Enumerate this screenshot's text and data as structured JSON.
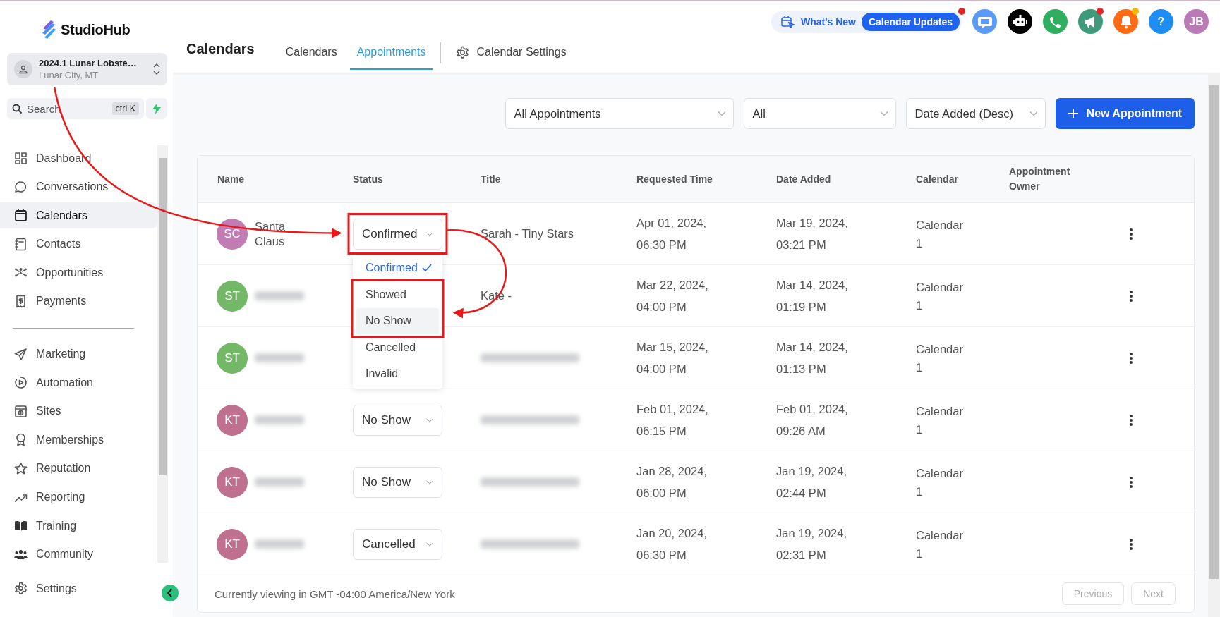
{
  "logo": {
    "text": "StudioHub"
  },
  "location": {
    "name": "2024.1 Lunar Lobste…",
    "place": "Lunar City, MT"
  },
  "search": {
    "placeholder": "Search",
    "shortcut": "ctrl K"
  },
  "sidebar": {
    "items": [
      {
        "label": "Dashboard",
        "selected": false
      },
      {
        "label": "Conversations",
        "selected": false
      },
      {
        "label": "Calendars",
        "selected": true
      },
      {
        "label": "Contacts",
        "selected": false
      },
      {
        "label": "Opportunities",
        "selected": false
      },
      {
        "label": "Payments",
        "selected": false
      }
    ],
    "more_items": [
      {
        "label": "Marketing",
        "selected": false
      },
      {
        "label": "Automation",
        "selected": false
      },
      {
        "label": "Sites",
        "selected": false
      },
      {
        "label": "Memberships",
        "selected": false
      },
      {
        "label": "Reputation",
        "selected": false
      },
      {
        "label": "Reporting",
        "selected": false
      },
      {
        "label": "Training",
        "selected": false
      },
      {
        "label": "Community",
        "selected": false
      }
    ],
    "settings": {
      "label": "Settings",
      "selected": false
    }
  },
  "header": {
    "title": "Calendars",
    "tabs": [
      {
        "label": "Calendars",
        "selected": false
      },
      {
        "label": "Appointments",
        "selected": true
      },
      {
        "label": "Calendar Settings",
        "selected": false,
        "kind": "settings"
      }
    ],
    "whats_new": {
      "label": "What's New",
      "badge": "Calendar Updates",
      "dot": true
    },
    "icons": [
      {
        "kind": "chat",
        "color": "#5b9bf8"
      },
      {
        "kind": "bot",
        "color": "#000000"
      },
      {
        "kind": "phone",
        "color": "#2fae60"
      },
      {
        "kind": "megaphone",
        "color": "#3f9a7c",
        "dot": {
          "color": "#e8262b"
        }
      },
      {
        "kind": "bell",
        "color": "#ff6a13",
        "dot": {
          "color": "#f5b800"
        }
      },
      {
        "kind": "help",
        "color": "#1e8ef5",
        "label": "?"
      },
      {
        "kind": "avatar",
        "color": "#b97ab5",
        "label": "JB"
      }
    ]
  },
  "filters": [
    {
      "value": "All Appointments"
    },
    {
      "value": "All"
    },
    {
      "value": "Date Added (Desc)"
    }
  ],
  "new_button": {
    "label": "New Appointment"
  },
  "table": {
    "columns": [
      "Name",
      "Status",
      "Title",
      "Requested Time",
      "Date Added",
      "Calendar",
      "Appointment Owner"
    ],
    "rows": [
      {
        "initials": "SC",
        "color": "#c17cb4",
        "name": "Santa Claus",
        "status": "Confirmed",
        "title": "Sarah - Tiny Stars",
        "requested": "Apr 01, 2024, 06:30 PM",
        "date_added": "Mar 19, 2024, 03:21 PM",
        "calendar": "Calendar 1",
        "status_menu": {
          "options": [
            {
              "label": "Confirmed",
              "selected": true,
              "highlighted": false
            },
            {
              "label": "Showed",
              "selected": false,
              "highlighted": false
            },
            {
              "label": "No Show",
              "selected": false,
              "highlighted": true
            },
            {
              "label": "Cancelled",
              "selected": false,
              "highlighted": false
            },
            {
              "label": "Invalid",
              "selected": false,
              "highlighted": false
            }
          ]
        }
      },
      {
        "initials": "ST",
        "color": "#72b866",
        "name_blurred": true,
        "title": "Kate -",
        "requested": "Mar 22, 2024, 04:00 PM",
        "date_added": "Mar 14, 2024, 01:19 PM",
        "calendar": "Calendar 1"
      },
      {
        "initials": "ST",
        "color": "#72b866",
        "name_blurred": true,
        "title_blurred": true,
        "requested": "Mar 15, 2024, 04:00 PM",
        "date_added": "Mar 14, 2024, 01:13 PM",
        "calendar": "Calendar 1"
      },
      {
        "initials": "KT",
        "color": "#c0708f",
        "name_blurred": true,
        "status": "No Show",
        "title_blurred": true,
        "requested": "Feb 01, 2024, 06:15 PM",
        "date_added": "Feb 01, 2024, 09:26 AM",
        "calendar": "Calendar 1"
      },
      {
        "initials": "KT",
        "color": "#c0708f",
        "name_blurred": true,
        "status": "No Show",
        "title_blurred": true,
        "requested": "Jan 28, 2024, 06:00 PM",
        "date_added": "Jan 19, 2024, 02:44 PM",
        "calendar": "Calendar 1"
      },
      {
        "initials": "KT",
        "color": "#c0708f",
        "name_blurred": true,
        "status": "Cancelled",
        "title_blurred": true,
        "requested": "Jan 20, 2024, 06:30 PM",
        "date_added": "Jan 19, 2024, 02:31 PM",
        "calendar": "Calendar 1"
      }
    ]
  },
  "footer": {
    "note": "Currently viewing in GMT -04:00 America/New York",
    "pages": [
      "Previous",
      "Next"
    ]
  }
}
